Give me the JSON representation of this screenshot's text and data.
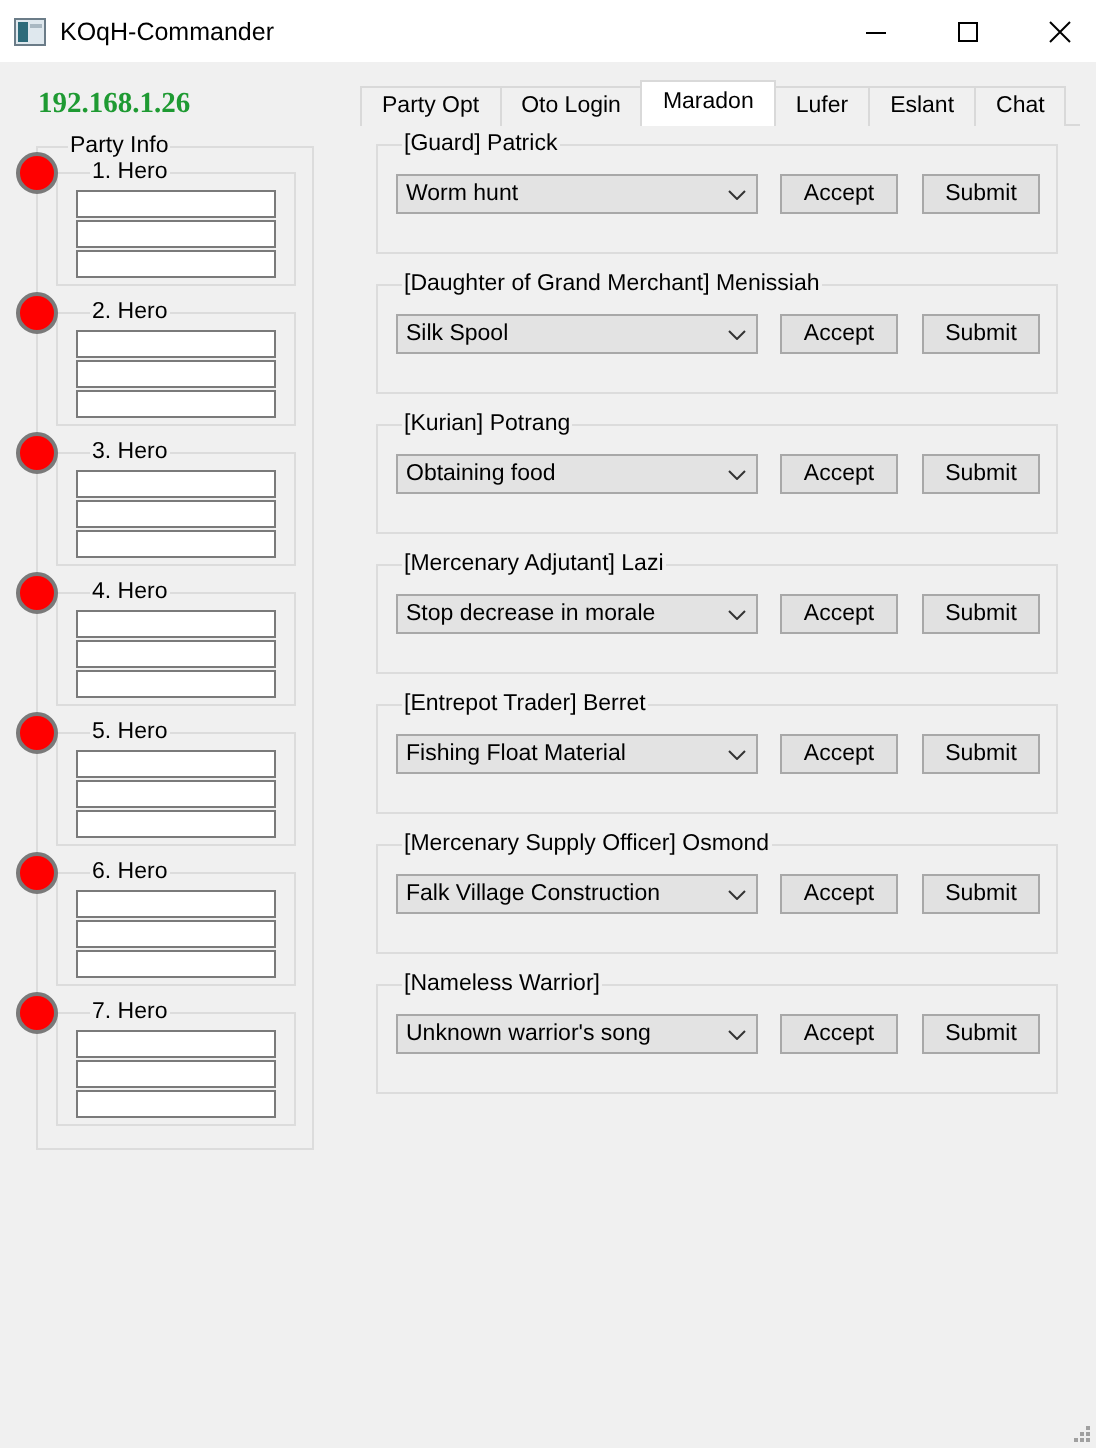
{
  "window": {
    "title": "KOqH-Commander"
  },
  "ip_address": "192.168.1.26",
  "party_info": {
    "title": "Party Info",
    "heroes": [
      {
        "label": "1. Hero",
        "color": "#ff0000"
      },
      {
        "label": "2. Hero",
        "color": "#ff0000"
      },
      {
        "label": "3. Hero",
        "color": "#ff0000"
      },
      {
        "label": "4. Hero",
        "color": "#ff0000"
      },
      {
        "label": "5. Hero",
        "color": "#ff0000"
      },
      {
        "label": "6. Hero",
        "color": "#ff0000"
      },
      {
        "label": "7. Hero",
        "color": "#ff0000"
      }
    ]
  },
  "tabs": [
    {
      "label": "Party Opt",
      "selected": false
    },
    {
      "label": "Oto Login",
      "selected": false
    },
    {
      "label": "Maradon",
      "selected": true
    },
    {
      "label": "Lufer",
      "selected": false
    },
    {
      "label": "Eslant",
      "selected": false
    },
    {
      "label": "Chat",
      "selected": false
    }
  ],
  "quests": [
    {
      "npc": "[Guard] Patrick",
      "quest": "Worm hunt",
      "buttons": [
        "Accept",
        "Submit"
      ]
    },
    {
      "npc": "[Daughter of Grand Merchant] Menissiah",
      "quest": "Silk Spool",
      "buttons": [
        "Accept",
        "Submit"
      ]
    },
    {
      "npc": "[Kurian] Potrang",
      "quest": "Obtaining food",
      "buttons": [
        "Accept",
        "Submit"
      ]
    },
    {
      "npc": "[Mercenary Adjutant] Lazi",
      "quest": "Stop decrease in morale",
      "buttons": [
        "Accept",
        "Submit"
      ]
    },
    {
      "npc": "[Entrepot Trader] Berret",
      "quest": "Fishing Float Material",
      "buttons": [
        "Accept",
        "Submit"
      ]
    },
    {
      "npc": "[Mercenary Supply Officer] Osmond",
      "quest": "Falk Village Construction",
      "buttons": [
        "Accept",
        "Submit"
      ]
    },
    {
      "npc": "[Nameless Warrior]",
      "quest": "Unknown warrior's song",
      "buttons": [
        "Accept",
        "Submit"
      ]
    }
  ]
}
